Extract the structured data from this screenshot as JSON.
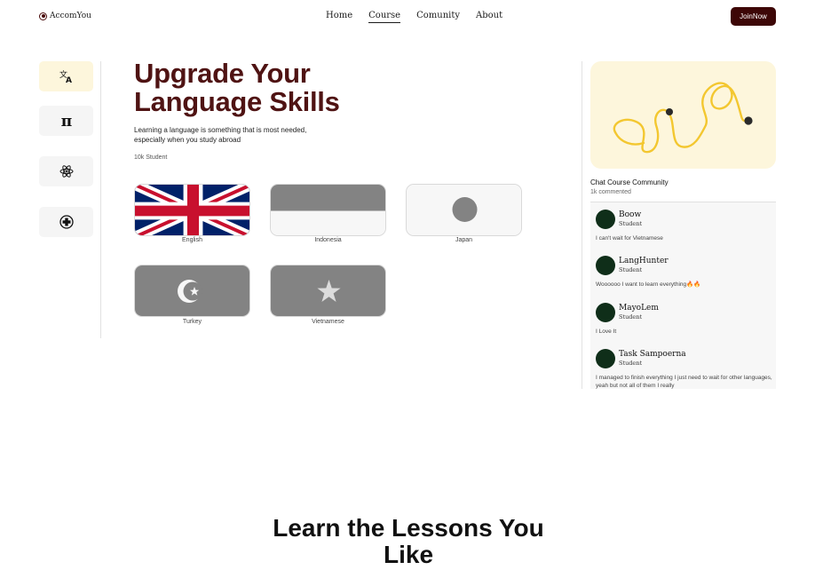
{
  "brand": {
    "name": "AccomYou"
  },
  "nav": {
    "items": [
      {
        "label": "Home",
        "active": false
      },
      {
        "label": "Course",
        "active": true
      },
      {
        "label": "Comunity",
        "active": false
      },
      {
        "label": "About",
        "active": false
      }
    ],
    "join_label": "JoinNow"
  },
  "sidebar": {
    "items": [
      {
        "icon": "translate-icon",
        "active": true
      },
      {
        "icon": "pi-icon",
        "active": false
      },
      {
        "icon": "atom-icon",
        "active": false
      },
      {
        "icon": "medical-cross-icon",
        "active": false
      }
    ]
  },
  "hero": {
    "title_line1": "Upgrade Your",
    "title_line2": "Language Skills",
    "subtitle": "Learning a language is something that is most needed, especially when you study abroad",
    "count": "10k Student"
  },
  "languages": [
    {
      "label": "English",
      "flag": "uk-flag-icon"
    },
    {
      "label": "Indonesia",
      "flag": "indonesia-flag-icon"
    },
    {
      "label": "Japan",
      "flag": "japan-flag-icon"
    },
    {
      "label": "Turkey",
      "flag": "turkey-flag-icon"
    },
    {
      "label": "Vietnamese",
      "flag": "vietnam-flag-icon"
    }
  ],
  "community": {
    "title": "Chat Course Community",
    "count": "1k commented",
    "comments": [
      {
        "name": "Boow",
        "role": "Student",
        "text": "I can't wait for Vietnamese"
      },
      {
        "name": "LangHunter",
        "role": "Student",
        "text": "Woooooo I want to learn everything🔥🔥"
      },
      {
        "name": "MayoLem",
        "role": "Student",
        "text": "I Love It"
      },
      {
        "name": "Task Sampoerna",
        "role": "Student",
        "text": "I managed to finish everything I just need to wait for other languages, yeah but not all of them I really"
      }
    ]
  },
  "lessons": {
    "title": "Learn the Lessons You Like"
  },
  "colors": {
    "accent": "#3d0707",
    "title": "#4f1313",
    "highlight": "#fdf6dc",
    "avatar": "#0f2e19",
    "squiggle": "#f3c730"
  }
}
